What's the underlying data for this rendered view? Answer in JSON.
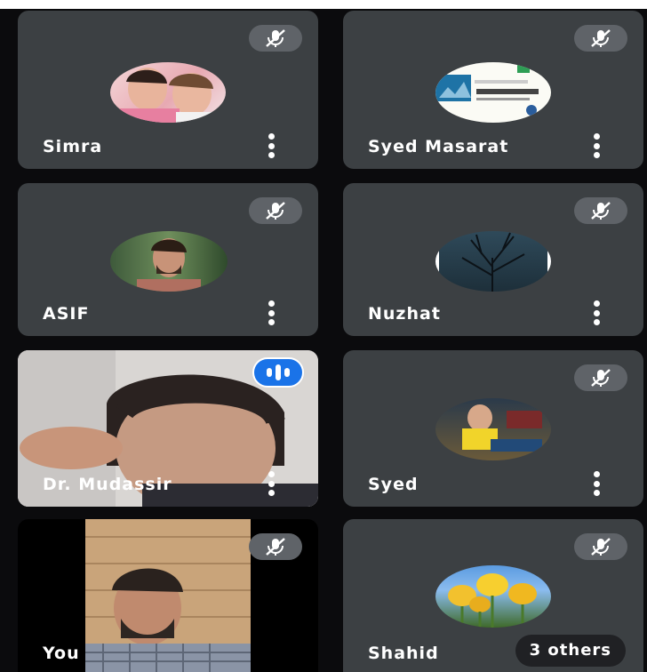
{
  "participants": [
    {
      "name": "Simra",
      "muted": true
    },
    {
      "name": "Syed Masarat",
      "muted": true
    },
    {
      "name": "ASIF",
      "muted": true
    },
    {
      "name": "Nuzhat",
      "muted": true
    },
    {
      "name": "Dr. Mudassir",
      "muted": false,
      "speaking": true
    },
    {
      "name": "Syed",
      "muted": true
    },
    {
      "name": "You",
      "muted": true
    },
    {
      "name": "Shahid",
      "muted": true
    }
  ],
  "others_label": "3 others",
  "colors": {
    "tile": "#3c4043",
    "mute_chip": "#5f6368",
    "speaking": "#1a73e8"
  }
}
